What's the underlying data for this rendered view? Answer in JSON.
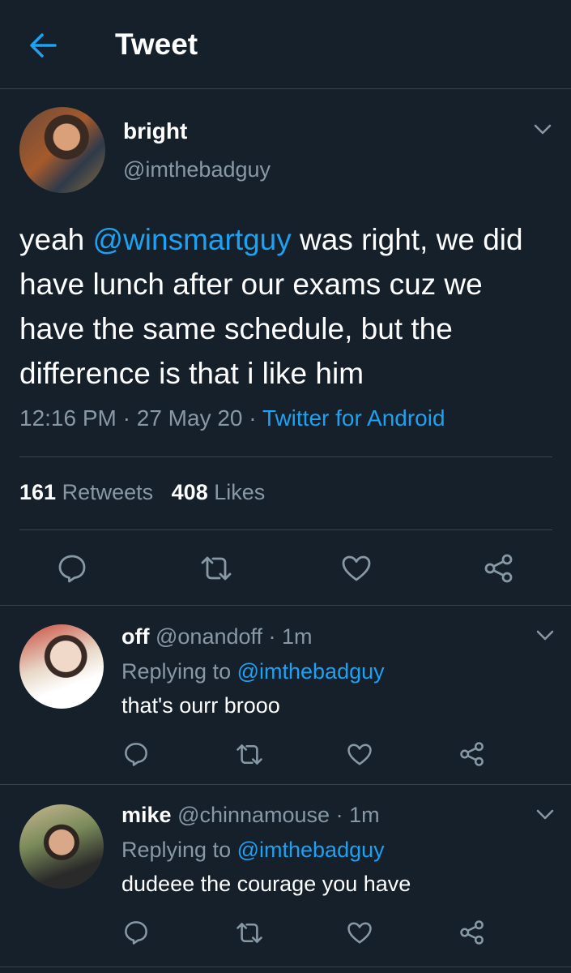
{
  "header": {
    "title": "Tweet",
    "back_icon": "back-arrow-icon"
  },
  "tweet": {
    "author_name": "bright",
    "author_handle": "@imthebadguy",
    "text_before": "yeah ",
    "text_mention": "@winsmartguy",
    "text_after": " was right, we did have lunch after our exams cuz we have the same schedule, but the difference is that i like him",
    "time": "12:16 PM",
    "date": "27 May 20",
    "separator": "·",
    "source": "Twitter for Android",
    "retweets_count": "161",
    "retweets_label": "Retweets",
    "likes_count": "408",
    "likes_label": "Likes"
  },
  "replies": [
    {
      "name": "off",
      "handle": "@onandoff",
      "time": "· 1m",
      "replying_label": "Replying to",
      "replying_to": "@imthebadguy",
      "text": "that's ourr brooo"
    },
    {
      "name": "mike",
      "handle": "@chinnamouse",
      "time": "· 1m",
      "replying_label": "Replying to",
      "replying_to": "@imthebadguy",
      "text": "dudeee the courage you have"
    }
  ],
  "colors": {
    "background": "#15202b",
    "accent": "#1da1f2",
    "secondary_text": "#8899a6",
    "divider": "#38444d"
  },
  "icons": [
    "back-arrow-icon",
    "chevron-down-icon",
    "reply-icon",
    "retweet-icon",
    "like-icon",
    "share-icon"
  ]
}
